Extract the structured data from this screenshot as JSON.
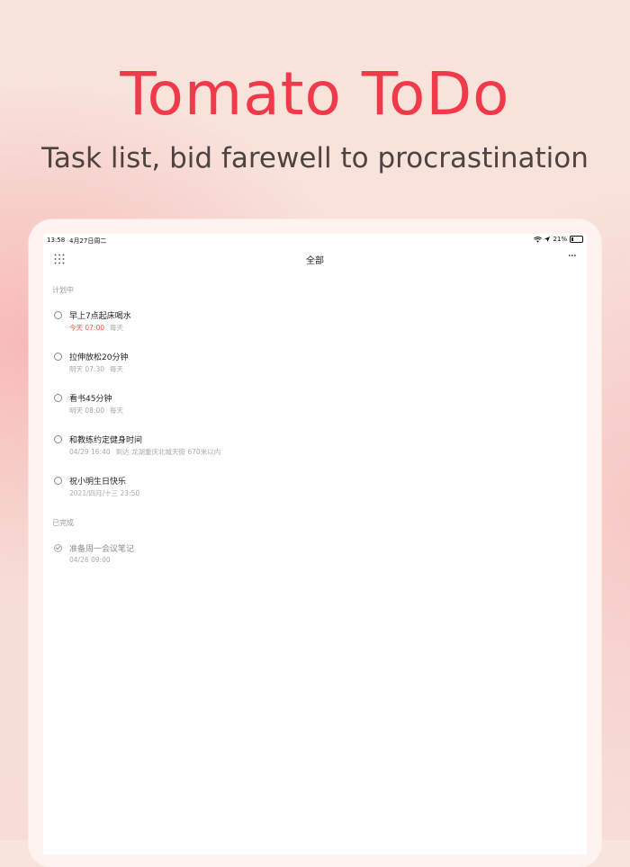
{
  "hero": {
    "title": "Tomato ToDo",
    "subtitle": "Task list, bid farewell to procrastination"
  },
  "status_bar": {
    "time": "13:58",
    "date": "4月27日周二",
    "battery": "21%",
    "battery_level": 0.21
  },
  "nav": {
    "title": "全部",
    "more": "···"
  },
  "sections": {
    "planned": "计划中",
    "completed": "已完成"
  },
  "tasks": [
    {
      "title": "早上7点起床喝水",
      "when": "今天 07:00",
      "repeat": "每天",
      "when_highlight": true
    },
    {
      "title": "拉伸放松20分钟",
      "when": "明天 07:30",
      "repeat": "每天"
    },
    {
      "title": "看书45分钟",
      "when": "明天 08:00",
      "repeat": "每天"
    },
    {
      "title": "和教练约定健身时间",
      "when": "04/29 16:40",
      "repeat": "到达 龙湖重庆北城天街 670米以内"
    },
    {
      "title": "祝小明生日快乐",
      "when": "2021/四月/十三 23:50",
      "repeat": ""
    }
  ],
  "done_tasks": [
    {
      "title": "准备周一会议笔记",
      "when": "04/26 09:00"
    }
  ],
  "colors": {
    "accent": "#f03a4a",
    "highlight": "#ea5a3c"
  }
}
